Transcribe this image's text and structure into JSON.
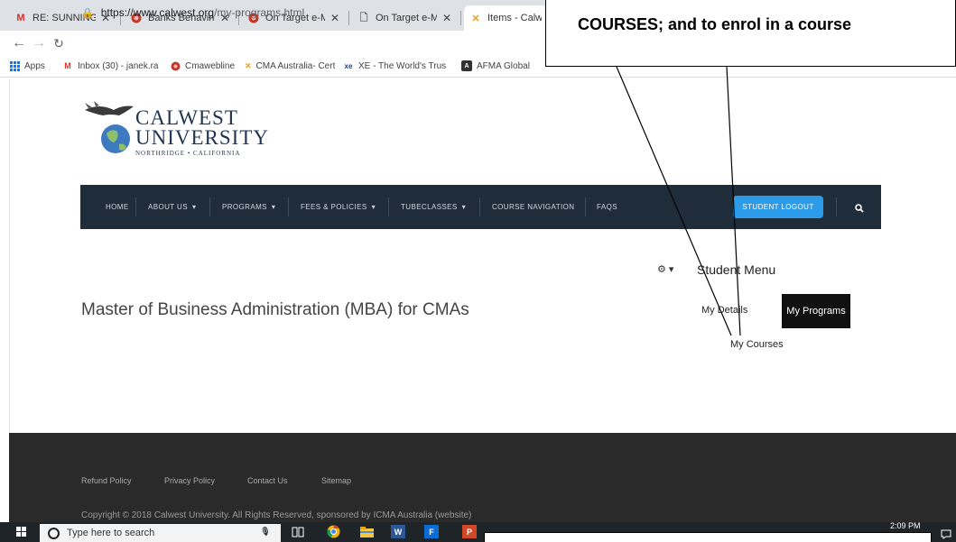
{
  "browser": {
    "tabs": [
      {
        "label": "RE: SUNNINGDALE",
        "icon": "gmail-icon"
      },
      {
        "label": "Banks Behaving B",
        "icon": "red-circle-icon"
      },
      {
        "label": "On Target e-Mag",
        "icon": "red-circle-icon"
      },
      {
        "label": "On Target e-Mag",
        "icon": "page-icon"
      },
      {
        "label": "Items - Calwes",
        "icon": "cma-icon"
      }
    ],
    "url_domain": "https://www.calwest.org",
    "url_path": "/my-programs.html",
    "bookmarks": [
      {
        "label": "Apps",
        "icon": "apps-grid-icon"
      },
      {
        "label": "Inbox (30) - janek.ra",
        "icon": "gmail-icon"
      },
      {
        "label": "Cmawebline",
        "icon": "red-circle-icon"
      },
      {
        "label": "CMA Australia- Certi",
        "icon": "cma-icon"
      },
      {
        "label": "XE - The World's Trus",
        "icon": "xe-icon"
      },
      {
        "label": "AFMA Global",
        "icon": "afma-icon"
      }
    ]
  },
  "site": {
    "logo": {
      "line1": "CALWEST",
      "line2": "UNIVERSITY",
      "line3": "NORTHRIDGE • CALIFORNIA"
    },
    "nav": [
      {
        "label": "HOME",
        "caret": ""
      },
      {
        "label": "ABOUT US",
        "caret": "▾"
      },
      {
        "label": "PROGRAMS",
        "caret": "▾"
      },
      {
        "label": "FEES & POLICIES",
        "caret": "▾"
      },
      {
        "label": "TUBECLASSES",
        "caret": "▾"
      },
      {
        "label": "COURSE NAVIGATION",
        "caret": ""
      },
      {
        "label": "FAQS",
        "caret": ""
      }
    ],
    "logout_label": "STUDENT LOGOUT",
    "student_menu": {
      "title": "Student Menu",
      "my_details": "My Details",
      "my_programs": "My Programs",
      "my_courses": "My Courses"
    },
    "program_title": "Master of Business Administration (MBA) for CMAs",
    "footer": {
      "links": [
        "Refund Policy",
        "Privacy Policy",
        "Contact Us",
        "Sitemap"
      ],
      "copyright": "Copyright © 2018 Calwest University. All Rights Reserved, sponsored by ICMA Australia (website)"
    }
  },
  "annotation": {
    "callout": "COURSES; and to enrol in a course"
  },
  "taskbar": {
    "search_placeholder": "Type here to search",
    "time": "2:09 PM"
  },
  "colors": {
    "navbar": "#1f2d3b",
    "logout": "#2b9bea",
    "footer": "#2a2a2a",
    "taskbar": "#1f2428"
  }
}
